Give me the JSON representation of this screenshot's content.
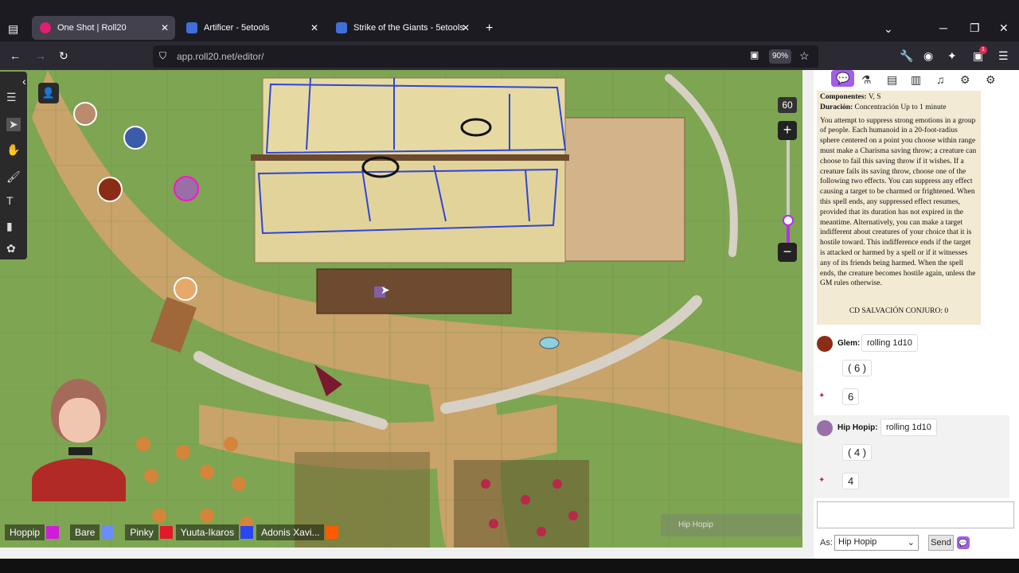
{
  "browser": {
    "tabs": [
      {
        "label": "One Shot | Roll20",
        "active": true
      },
      {
        "label": "Artificer - 5etools",
        "active": false
      },
      {
        "label": "Strike of the Giants - 5etools",
        "active": false
      }
    ],
    "new_tab_icon": "+",
    "url": "app.roll20.net/editor/",
    "zoom": "90%",
    "notification_count": "1"
  },
  "map": {
    "zoom_value": "60",
    "zoom_in": "+",
    "zoom_out": "−",
    "hover_tag": "Hip Hopip"
  },
  "players": [
    {
      "name": "Hoppip",
      "color": "#d01cd9"
    },
    {
      "name": "Bare",
      "color": "#6b8cff"
    },
    {
      "name": "Pinky",
      "color": "#e2182b"
    },
    {
      "name": "Yuuta-Ikaros",
      "color": "#2b46f0"
    },
    {
      "name": "Adonis Xavi...",
      "color": "#ff5a00"
    }
  ],
  "spell": {
    "components_label": "Componentes:",
    "components_value": "V, S",
    "duration_label": "Duración:",
    "duration_value": "Concentración Up to 1 minute",
    "description": "You attempt to suppress strong emotions in a group of people. Each humanoid in a 20-foot-radius sphere centered on a point you choose within range must make a Charisma saving throw; a creature can choose to fail this saving throw if it wishes. If a creature fails its saving throw, choose one of the following two effects. You can suppress any effect causing a target to be charmed or frightened. When this spell ends, any suppressed effect resumes, provided that its duration has not expired in the meantime. Alternatively, you can make a target indifferent about creatures of your choice that it is hostile toward. This indifference ends if the target is attacked or harmed by a spell or if it witnesses any of its friends being harmed. When the spell ends, the creature becomes hostile again, unless the GM rules otherwise.",
    "dc": "CD SALVACIÓN CONJURO: 0"
  },
  "chat": [
    {
      "who": "Glem:",
      "roll": "rolling 1d10",
      "dice": "( 6 )",
      "total": "6"
    },
    {
      "who": "Hip Hopip:",
      "roll": "rolling 1d10",
      "dice": "( 4 )",
      "total": "4"
    }
  ],
  "chat_controls": {
    "as_label": "As:",
    "as_value": "Hip Hopip",
    "send_label": "Send"
  }
}
